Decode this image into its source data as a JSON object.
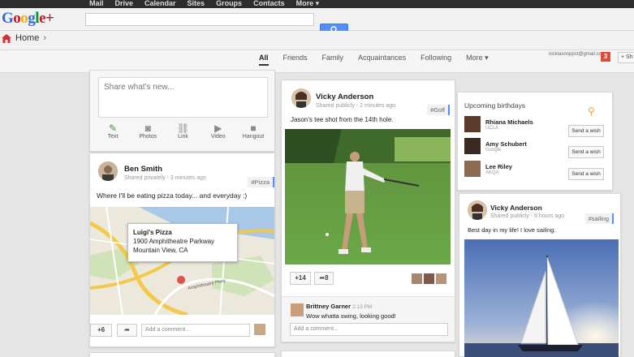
{
  "topnav": [
    "Mail",
    "Drive",
    "Calendar",
    "Sites",
    "Groups",
    "Contacts",
    "More"
  ],
  "logo": {
    "g1": "G",
    "o1": "o",
    "o2": "o",
    "g2": "g",
    "l": "l",
    "e": "e",
    "plus": "+"
  },
  "breadcrumb": {
    "label": "Home"
  },
  "filters": [
    "All",
    "Friends",
    "Family",
    "Acquaintances",
    "Following",
    "More"
  ],
  "account": {
    "email": "nicklasnoppst@gmail.com",
    "notifications": "3",
    "share_label": "+ Sh"
  },
  "sharebox": {
    "placeholder": "Share what's new...",
    "actions": [
      {
        "label": "Text",
        "icon": "pencil-icon"
      },
      {
        "label": "Photos",
        "icon": "camera-icon"
      },
      {
        "label": "Link",
        "icon": "link-icon"
      },
      {
        "label": "Video",
        "icon": "video-icon"
      },
      {
        "label": "Hangout",
        "icon": "hangout-icon"
      }
    ]
  },
  "post_ben": {
    "author": "Ben Smith",
    "meta": "Shared privately - 3 minutes ago",
    "tag": "#Pizza",
    "text": "Where I'll be eating pizza today... and everyday :)",
    "map": {
      "name": "Luigi's Pizza",
      "address1": "1900 Amphitheatre Parkway",
      "address2": "Mountain View, CA",
      "road1": "Amphitheatre Pkwy"
    },
    "plus": "+6",
    "comment_placeholder": "Add a comment..."
  },
  "post_vicky1": {
    "author": "Vicky Anderson",
    "meta": "Shared publicly - 2 minutes ago",
    "tag": "#Golf",
    "text": "Jason's tee shot from the 14th hole.",
    "plus": "+14",
    "shares": "8",
    "comment": {
      "author": "Brittney Garner",
      "time": "2:13 PM",
      "text": "Wow whatta swing, looking good!"
    },
    "comment_placeholder": "Add a comment..."
  },
  "birthdays": {
    "title": "Upcoming birthdays",
    "people": [
      {
        "name": "Rhiana Michaels",
        "sub": "UCLA",
        "button": "Send a wish"
      },
      {
        "name": "Amy Schubert",
        "sub": "Google",
        "button": "Send a wish"
      },
      {
        "name": "Lee Riley",
        "sub": "AKQA",
        "button": "Send a wish"
      }
    ]
  },
  "post_vicky2": {
    "author": "Vicky Anderson",
    "meta": "Shared publicly - 6 hours ago",
    "tag": "#sailing",
    "text": "Best day in my life! I love sailing."
  },
  "colors": {
    "accent": "#4d90fe",
    "notif": "#dd4b39",
    "topbar": "#2d2d2d"
  }
}
